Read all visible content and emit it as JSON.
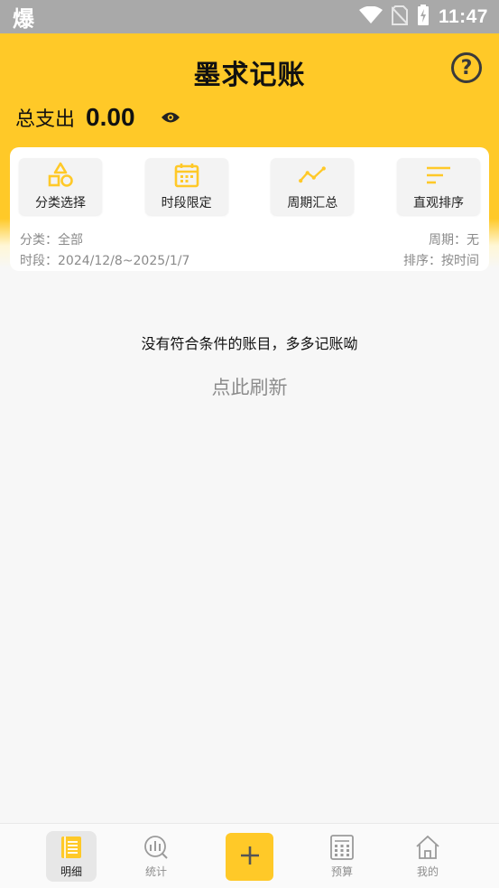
{
  "status_bar": {
    "app_glyph": "爆",
    "time": "11:47"
  },
  "header": {
    "title": "墨求记账",
    "help_icon": "help-circle-icon",
    "total_label": "总支出",
    "total_amount": "0.00"
  },
  "filter_card": {
    "tools": [
      {
        "label": "分类选择",
        "icon": "shapes-icon"
      },
      {
        "label": "时段限定",
        "icon": "calendar-icon"
      },
      {
        "label": "周期汇总",
        "icon": "trend-line-icon"
      },
      {
        "label": "直观排序",
        "icon": "sort-lines-icon"
      }
    ],
    "category": "分类：全部",
    "period": "周期：无",
    "time_range": "时段：2024/12/8~2025/1/7",
    "sort": "排序：按时间"
  },
  "empty_state": {
    "message": "没有符合条件的账目，多多记账呦",
    "refresh": "点此刷新"
  },
  "bottom_nav": {
    "items": [
      {
        "label": "明细",
        "icon": "list-icon",
        "active": true
      },
      {
        "label": "统计",
        "icon": "chart-icon",
        "active": false
      },
      {
        "label": "预算",
        "icon": "calculator-icon",
        "active": false
      },
      {
        "label": "我的",
        "icon": "home-icon",
        "active": false
      }
    ],
    "add_icon": "plus-icon"
  },
  "colors": {
    "accent": "#ffc928",
    "background": "#f7f7f7"
  }
}
